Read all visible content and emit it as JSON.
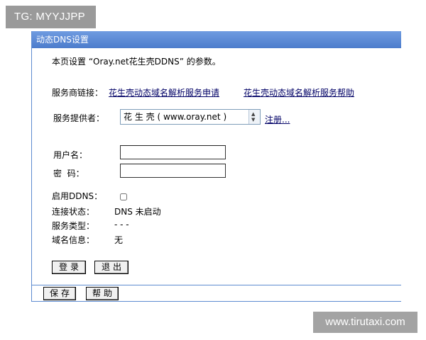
{
  "watermarks": {
    "top_left": "TG: MYYJJPP",
    "bottom_right": "www.tirutaxi.com"
  },
  "panel": {
    "title": "动态DNS设置"
  },
  "intro": "本页设置 “Oray.net花生壳DDNS” 的参数。",
  "service_links": {
    "label": "服务商链接：",
    "apply_link": "花生壳动态域名解析服务申请",
    "help_link": "花生壳动态域名解析服务帮助"
  },
  "provider": {
    "label": "服务提供者：",
    "selected": "花 生 壳 ( www.oray.net )",
    "register_link": "注册..."
  },
  "login": {
    "username_label": "用户名：",
    "username_value": "",
    "password_label": "密  码：",
    "password_value": ""
  },
  "status": {
    "enable_label": "启用DDNS：",
    "enabled": false,
    "connection_label": "连接状态：",
    "connection_value": "DNS 未启动",
    "service_type_label": "服务类型：",
    "service_type_value": "- - -",
    "domain_info_label": "域名信息：",
    "domain_info_value": "无"
  },
  "actions": {
    "login": "登录",
    "logout": "退出"
  },
  "footer": {
    "save": "保存",
    "help": "帮助"
  }
}
